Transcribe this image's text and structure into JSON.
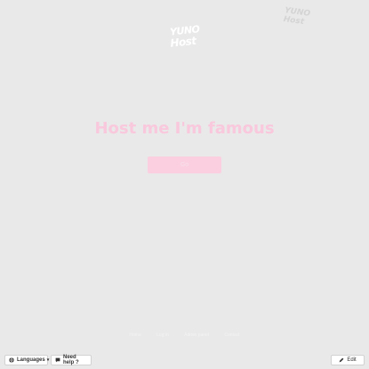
{
  "logo": {
    "line1": "YUNO",
    "line2": "Host"
  },
  "corner_logo": {
    "line1": "YUNO",
    "line2": "Host"
  },
  "hero": {
    "headline": "Host me I'm famous",
    "button_label": "Go"
  },
  "footer": {
    "links": [
      "Home",
      "Log in",
      "Admin panel",
      "Contact"
    ]
  },
  "bottom_bar": {
    "languages_label": "Languages",
    "help_label": "Need help ?",
    "edit_label": "Edit"
  },
  "colors": {
    "background": "#e9e9e9",
    "accent_pink": "#f9c8dc",
    "button_pink": "#fbcfe0"
  },
  "icons": {
    "languages": "globe-icon",
    "help": "chat-icon",
    "edit": "pencil-icon"
  }
}
